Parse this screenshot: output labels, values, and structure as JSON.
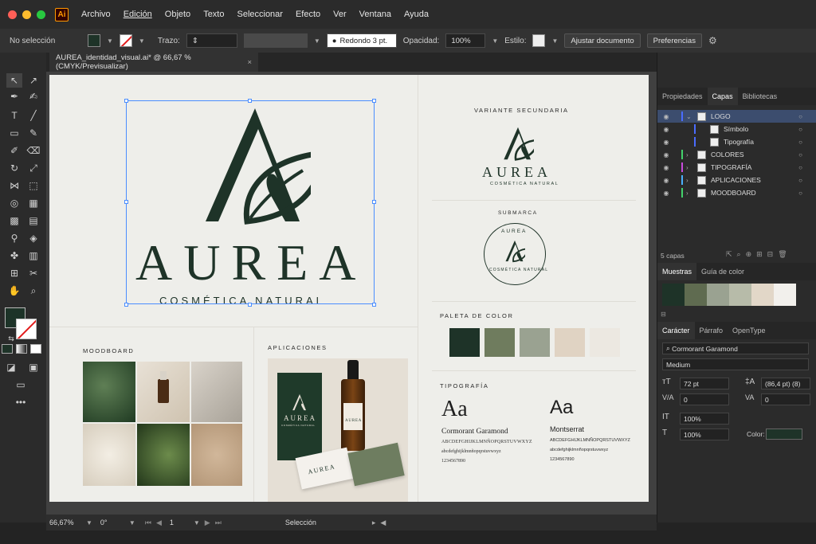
{
  "menubar": {
    "app_icon": "Ai",
    "items": [
      "Archivo",
      "Edición",
      "Objeto",
      "Texto",
      "Seleccionar",
      "Efecto",
      "Ver",
      "Ventana",
      "Ayuda"
    ]
  },
  "controlbar": {
    "selection": "No selección",
    "stroke_label": "Trazo:",
    "brush": "Redondo 3 pt.",
    "opacity_label": "Opacidad:",
    "opacity_value": "100%",
    "style_label": "Estilo:",
    "adjust_button": "Ajustar documento",
    "prefs_button": "Preferencias"
  },
  "tab": {
    "title": "AUREA_identidad_visual.ai* @ 66,67 % (CMYK/Previsualizar)",
    "close": "×"
  },
  "artboard": {
    "logo": {
      "letter": "A",
      "brand": "AUREA",
      "tagline": "COSMÉTICA NATURAL"
    },
    "secondary": {
      "label": "VARIANTE SECUNDARIA",
      "brand": "AUREA",
      "tagline": "COSMÉTICA NATURAL"
    },
    "submark": {
      "label": "SUBMARCA",
      "ring_top": "AUREA",
      "ring_bottom": "COSMÉTICA NATURAL"
    },
    "palette": {
      "label": "PALETA DE COLOR",
      "colors": [
        "#1e3328",
        "#6f7c5e",
        "#9aa291",
        "#e0d3c3",
        "#ece8e1"
      ]
    },
    "typography": {
      "label": "TIPOGRAFÍA",
      "fonts": [
        {
          "sample": "Aa",
          "name": "Cormorant Garamond",
          "upper": "ABCDEFGHIJKLMNÑOPQRSTUVWXYZ",
          "lower": "abcdefghijklmnñopqrstuvwxyz",
          "digits": "1234567890"
        },
        {
          "sample": "Aa",
          "name": "Montserrat",
          "upper": "ABCDEFGHIJKLMNÑOPQRSTUVWXYZ",
          "lower": "abcdefghijklmnñopqrstuvwxyz",
          "digits": "1234567890"
        }
      ]
    },
    "moodboard": {
      "label": "MOODBOARD"
    },
    "applications": {
      "label": "APLICACIONES",
      "box_brand": "AUREA",
      "box_tagline": "COSMÉTICA NATURAL",
      "bottle_brand": "AUREA",
      "card_brand": "AUREA"
    }
  },
  "panels": {
    "top_tabs": [
      "Propiedades",
      "Capas",
      "Bibliotecas"
    ],
    "layers": [
      {
        "name": "LOGO",
        "color": "#4a6cff",
        "expanded": true
      },
      {
        "name": "Símbolo",
        "color": "#4a6cff",
        "child": true
      },
      {
        "name": "Tipografía",
        "color": "#4a6cff",
        "child": true
      },
      {
        "name": "COLORES",
        "color": "#43d26b"
      },
      {
        "name": "TIPOGRAFÍA",
        "color": "#c94bdd"
      },
      {
        "name": "APLICACIONES",
        "color": "#4ab0ff"
      },
      {
        "name": "MOODBOARD",
        "color": "#43d26b"
      }
    ],
    "layer_count": "5 capas",
    "swatch_tabs": [
      "Muestras",
      "Guía de color"
    ],
    "swatches": [
      "#1e3328",
      "#5f6b50",
      "#9aa291",
      "#b7bba9",
      "#e2d7c8",
      "#f2f0ec"
    ],
    "char_tabs": [
      "Carácter",
      "Párrafo",
      "OpenType"
    ],
    "font_family": "Cormorant Garamond",
    "font_style": "Medium",
    "size": "72 pt",
    "leading": "(86,4 pt) (8)",
    "kerning": "0",
    "tracking": "0",
    "vscale": "100%",
    "hscale": "100%",
    "color_label": "Color:",
    "color_value": "#1e3328"
  },
  "statusbar": {
    "zoom": "66,67%",
    "rotation": "0°",
    "artboard": "1",
    "tool": "Selección"
  }
}
